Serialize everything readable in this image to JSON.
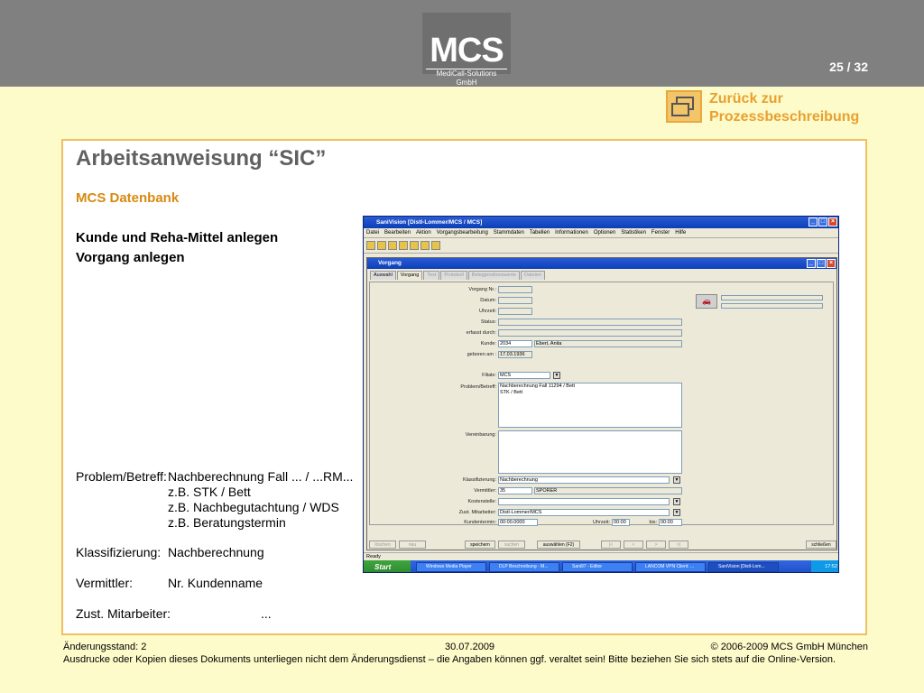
{
  "header": {
    "logo_big": "MCS",
    "logo_small": "MediCall-Solutions GmbH",
    "page_number": "25 / 32"
  },
  "back_link": {
    "line1": "Zurück zur",
    "line2": "Prozessbeschreibung"
  },
  "slide": {
    "title": "Arbeitsanweisung “SIC”",
    "subtitle": "MCS Datenbank",
    "heading_line1": "Kunde und Reha-Mittel anlegen",
    "heading_line2": "Vorgang anlegen",
    "problem_label": "Problem/Betreff:",
    "problem_value": "Nachberechnung Fall ... / ...RM...",
    "problem_ex1": "z.B. STK / Bett",
    "problem_ex2": "z.B. Nachbegutachtung / WDS",
    "problem_ex3": "z.B. Beratungstermin",
    "klass_label": "Klassifizierung:",
    "klass_value": "Nachberechnung",
    "verm_label": "Vermittler:",
    "verm_value": "Nr. Kundenname",
    "zust_label": "Zust. Mitarbeiter:",
    "zust_value": "..."
  },
  "footer": {
    "status": "Änderungsstand: 2",
    "date": "30.07.2009",
    "copyright": "© 2006-2009 MCS GmbH München",
    "disclaimer": "Ausdrucke oder Kopien dieses Dokuments unterliegen nicht dem Änderungsdienst – die Angaben können ggf. veraltet sein! Bitte beziehen Sie sich stets auf die Online-Version."
  },
  "app": {
    "title": "SaniVision [Distl-Lommer/MCS / MCS]",
    "menu": [
      "Datei",
      "Bearbeiten",
      "Aktion",
      "Vorgangsbearbeitung",
      "Stammdaten",
      "Tabellen",
      "Informationen",
      "Optionen",
      "Statistiken",
      "Fenster",
      "Hilfe"
    ],
    "inner_title": "Vorgang",
    "tabs": [
      "Auswahl",
      "Vorgang",
      "Text",
      "Protokoll",
      "Belegpositionswerte",
      "Dateien"
    ],
    "labels": {
      "vorgang_nr": "Vorgang Nr.:",
      "datum": "Datum:",
      "uhrzeit": "Uhrzeit:",
      "status": "Status:",
      "erfasst": "erfasst durch:",
      "kunde": "Kunde:",
      "geboren": "geboren am :",
      "filiale": "Filiale:",
      "problem": "Problem/Betreff:",
      "vereinbarung": "Vereinbarung:",
      "klassifizierung": "Klassifizierung:",
      "vermittler": "Vermittler:",
      "kostenstelle": "Kostenstelle:",
      "zust": "Zust. Mitarbeiter:",
      "kundentermin": "Kundentermin:",
      "uhrzeit2": "Uhrzeit:",
      "bis": "bis:"
    },
    "values": {
      "kunde_nr": "2034",
      "kunde_name": "Ebert, Anita",
      "geboren": "17.03.1936",
      "filiale": "MCS",
      "problem_line1": "Nachberechnung Fall 11294 / Bett",
      "problem_line2": "STK / Bett",
      "klassifizierung": "Nachberechnung",
      "vermittler_nr": "35",
      "vermittler_name": "SPÖRER",
      "zust": "Distl-Lommer/MCS",
      "kundentermin": "00:00.0000",
      "uhrzeit_von": "00:00",
      "uhrzeit_bis": "00:00"
    },
    "buttons": [
      "löschen",
      "neu",
      "speichern",
      "suchen",
      "auswählen (F2)",
      "|<",
      "<",
      "<",
      ">",
      ">|",
      "schließen"
    ],
    "status": "Ready",
    "taskbar": {
      "start": "Start",
      "tasks": [
        "Windows Media Player",
        "DLP Beschreibung - M...",
        "Sani97 - Editor",
        "LANCOM VPN Client: ...",
        "SaniVision [Distl-Lom..."
      ],
      "clock": "17:52"
    }
  }
}
